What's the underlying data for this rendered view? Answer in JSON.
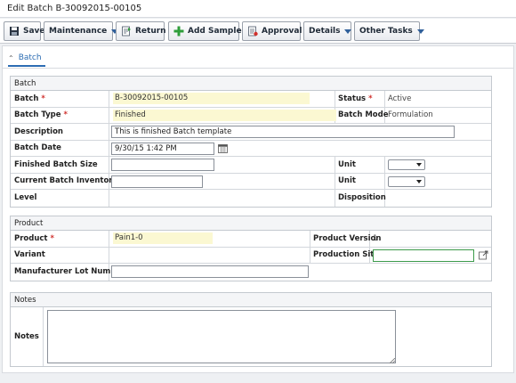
{
  "window": {
    "title": "Edit Batch B-30092015-00105"
  },
  "toolbar": {
    "save": "Save",
    "maintenance": "Maintenance",
    "return": "Return",
    "add_samples": "Add Samples",
    "approval": "Approval",
    "details": "Details",
    "other_tasks": "Other Tasks"
  },
  "tab": {
    "label": "Batch"
  },
  "batch": {
    "header": "Batch",
    "batch_label": "Batch",
    "batch_value": "B-30092015-00105",
    "status_label": "Status",
    "status_value": "Active",
    "type_label": "Batch Type",
    "type_value": "Finished",
    "mode_label": "Batch Mode",
    "mode_value": "Formulation",
    "description_label": "Description",
    "description_value": "This is finished Batch template",
    "date_label": "Batch Date",
    "date_value": "9/30/15 1:42 PM",
    "size_label": "Finished Batch Size",
    "size_value": "",
    "unit_label": "Unit",
    "inventory_label": "Current Batch Inventory",
    "inventory_value": "",
    "unit2_label": "Unit",
    "level_label": "Level",
    "disposition_label": "Disposition"
  },
  "product": {
    "header": "Product",
    "product_label": "Product",
    "product_value": "Pain1-0",
    "version_label": "Product Version",
    "version_value": "1",
    "variant_label": "Variant",
    "site_label": "Production Site",
    "site_value": "",
    "lot_label": "Manufacturer Lot Number",
    "lot_value": ""
  },
  "notes": {
    "header": "Notes",
    "notes_label": "Notes",
    "notes_value": ""
  },
  "icons": {
    "save": "save-icon",
    "return": "return-icon",
    "add_samples": "plus-icon",
    "approval": "approval-icon",
    "calendar": "calendar-icon",
    "external_link": "external-link-icon",
    "tab_collapse": "chevron-up-icon"
  },
  "colors": {
    "required": "#d0312d",
    "accent": "#2d6db3",
    "readonly_bg": "#fbf8d2",
    "add_icon": "#2e9e3a"
  }
}
